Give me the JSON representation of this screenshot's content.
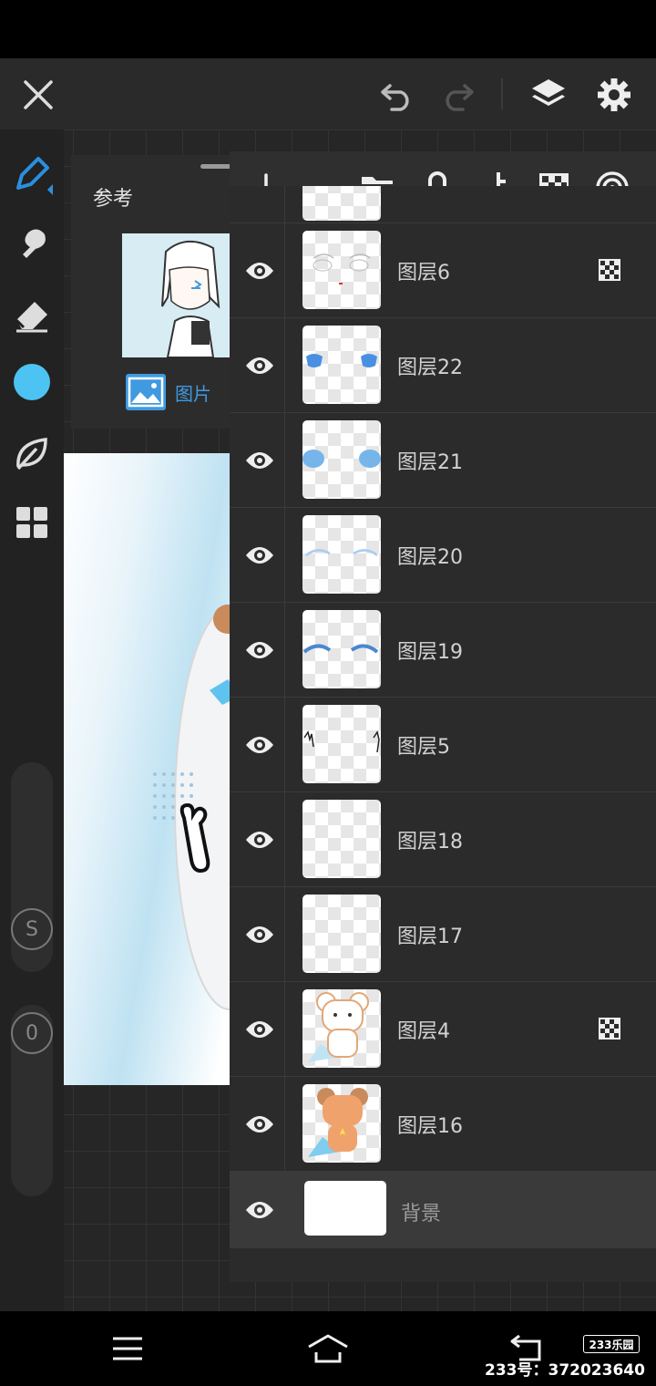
{
  "toolbar": {
    "close_icon": "close-icon",
    "undo_icon": "undo-icon",
    "redo_icon": "redo-icon",
    "layers_icon": "layers-icon",
    "settings_icon": "gear-icon"
  },
  "left_tools": [
    "pen-icon",
    "smudge-icon",
    "eraser-icon",
    "color-swatch",
    "leaf-icon",
    "grid-icon"
  ],
  "left_tools_colors": {
    "active": "#2a8fe0",
    "swatch": "#4cc3f2"
  },
  "size_buttons": {
    "s_label": "S",
    "o_label": "0"
  },
  "reference": {
    "label": "参考",
    "image_label": "图片"
  },
  "layer_toolbar": [
    "add-icon",
    "folder-icon",
    "lock-icon",
    "merge-down-icon",
    "transparency-icon",
    "target-icon"
  ],
  "layers": [
    {
      "name": "图层6",
      "clip": true
    },
    {
      "name": "图层22",
      "clip": false
    },
    {
      "name": "图层21",
      "clip": false
    },
    {
      "name": "图层20",
      "clip": false
    },
    {
      "name": "图层19",
      "clip": false
    },
    {
      "name": "图层5",
      "clip": false
    },
    {
      "name": "图层18",
      "clip": false
    },
    {
      "name": "图层17",
      "clip": false
    },
    {
      "name": "图层4",
      "clip": true
    },
    {
      "name": "图层16",
      "clip": false
    }
  ],
  "background_layer": {
    "name": "背景"
  },
  "navbar": {
    "menu_icon": "menu-icon",
    "home_icon": "home-icon",
    "back_icon": "back-icon"
  },
  "watermark": {
    "logo": "233乐园",
    "text": "233号：372023640"
  }
}
